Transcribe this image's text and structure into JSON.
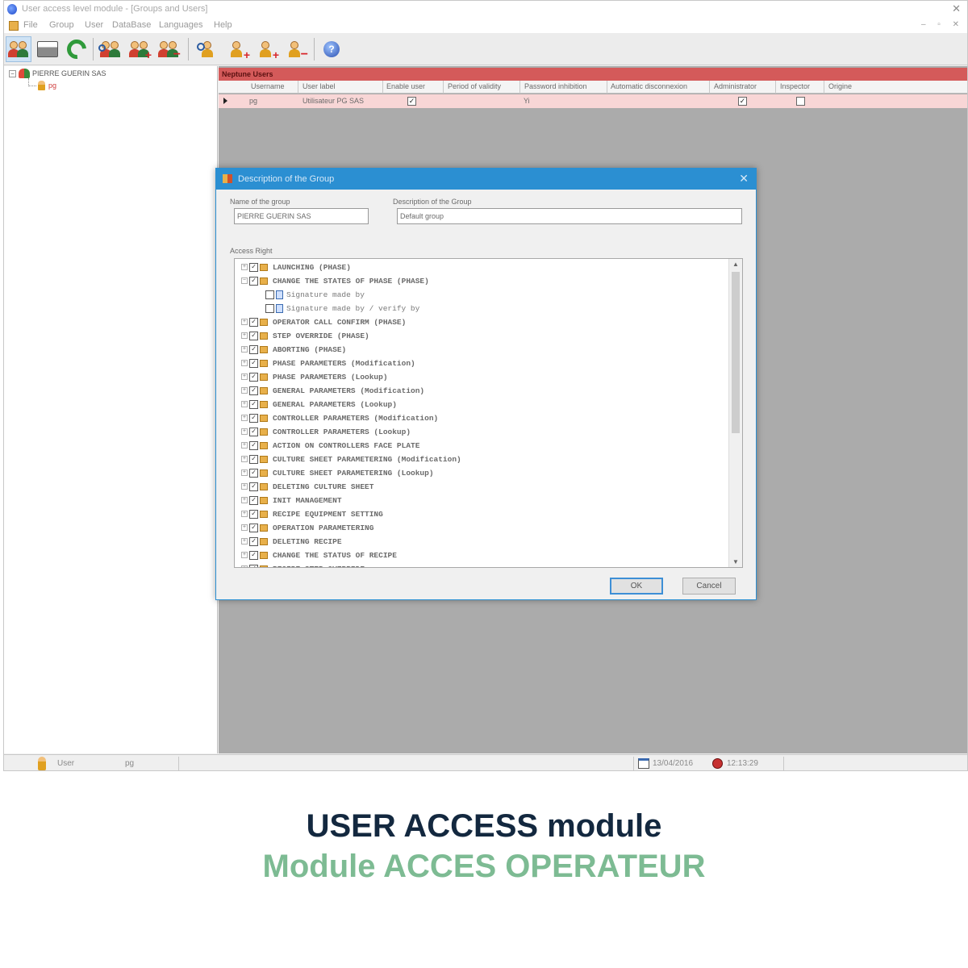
{
  "window": {
    "title": "User access level module - [Groups and Users]",
    "controls": "– ▫ ✕"
  },
  "menu": [
    "File",
    "Group",
    "User",
    "DataBase",
    "Languages",
    "Help"
  ],
  "tree": {
    "group_name": "PIERRE GUERIN SAS",
    "user_name": "pg"
  },
  "grid": {
    "title": "Neptune Users",
    "columns": [
      "Username",
      "User label",
      "Enable user",
      "Period of validity",
      "Password inhibition",
      "Automatic disconnexion",
      "Administrator",
      "Inspector",
      "Origine"
    ],
    "row": {
      "username": "pg",
      "user_label": "Utilisateur PG SAS",
      "enable_user": "✓",
      "password_inhibition": "Yi",
      "administrator": "✓",
      "inspector": ""
    }
  },
  "dialog": {
    "title": "Description of the Group",
    "name_label": "Name of the group",
    "name_value": "PIERRE GUERIN SAS",
    "desc_label": "Description of the Group",
    "desc_value": "Default group",
    "rights_label": "Access Right",
    "ok_label": "OK",
    "cancel_label": "Cancel",
    "rights": [
      {
        "label": "LAUNCHING (PHASE)",
        "level": 0,
        "checked": true
      },
      {
        "label": "CHANGE THE STATES OF PHASE (PHASE)",
        "level": 0,
        "checked": true
      },
      {
        "label": "Signature made by",
        "level": 1,
        "checked": false
      },
      {
        "label": "Signature made by / verify by",
        "level": 1,
        "checked": false
      },
      {
        "label": "OPERATOR CALL CONFIRM (PHASE)",
        "level": 0,
        "checked": true
      },
      {
        "label": "STEP OVERRIDE (PHASE)",
        "level": 0,
        "checked": true
      },
      {
        "label": "ABORTING (PHASE)",
        "level": 0,
        "checked": true
      },
      {
        "label": "PHASE PARAMETERS (Modification)",
        "level": 0,
        "checked": true
      },
      {
        "label": "PHASE PARAMETERS (Lookup)",
        "level": 0,
        "checked": true
      },
      {
        "label": "GENERAL PARAMETERS (Modification)",
        "level": 0,
        "checked": true
      },
      {
        "label": "GENERAL PARAMETERS (Lookup)",
        "level": 0,
        "checked": true
      },
      {
        "label": "CONTROLLER PARAMETERS (Modification)",
        "level": 0,
        "checked": true
      },
      {
        "label": "CONTROLLER PARAMETERS (Lookup)",
        "level": 0,
        "checked": true
      },
      {
        "label": "ACTION ON CONTROLLERS FACE PLATE",
        "level": 0,
        "checked": true
      },
      {
        "label": "CULTURE SHEET PARAMETERING  (Modification)",
        "level": 0,
        "checked": true
      },
      {
        "label": "CULTURE SHEET PARAMETERING  (Lookup)",
        "level": 0,
        "checked": true
      },
      {
        "label": "DELETING CULTURE SHEET",
        "level": 0,
        "checked": true
      },
      {
        "label": "INIT MANAGEMENT",
        "level": 0,
        "checked": true
      },
      {
        "label": "RECIPE EQUIPMENT SETTING",
        "level": 0,
        "checked": true
      },
      {
        "label": "OPERATION PARAMETERING",
        "level": 0,
        "checked": true
      },
      {
        "label": "DELETING RECIPE",
        "level": 0,
        "checked": true
      },
      {
        "label": "CHANGE THE STATUS OF RECIPE",
        "level": 0,
        "checked": true
      },
      {
        "label": "RECIPE STEP OVERRIDE",
        "level": 0,
        "checked": true
      }
    ]
  },
  "status": {
    "user_label": "User",
    "user_value": "pg",
    "date": "13/04/2016",
    "time": "12:13:29"
  },
  "caption": {
    "line1": "USER ACCESS module",
    "line2": "Module ACCES OPERATEUR"
  }
}
